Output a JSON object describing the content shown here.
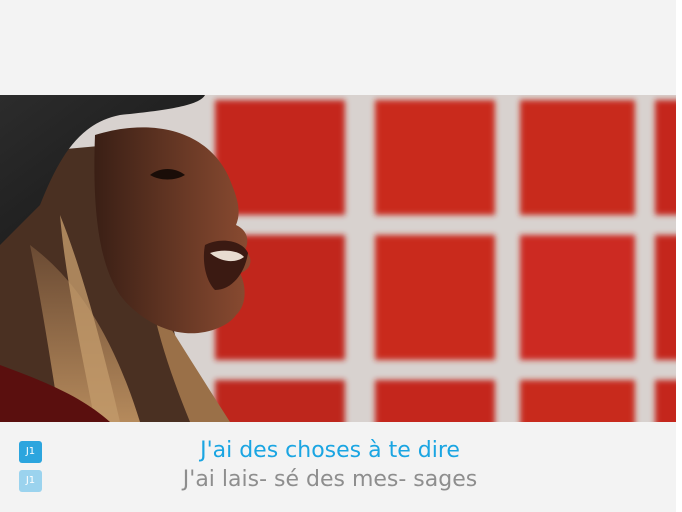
{
  "lyrics": {
    "current_line": "J'ai des choses à te dire",
    "next_line": "J'ai lais- sé des mes- sages",
    "player_badges": [
      "J1",
      "J1"
    ]
  },
  "colors": {
    "active_lyric": "#1aa5e2",
    "upcoming_lyric": "#8e8e8e",
    "badge_active": "#2ca5de",
    "badge_inactive": "#9bd3ee",
    "background": "#f3f3f3",
    "video_wall_red": "#b11812"
  }
}
